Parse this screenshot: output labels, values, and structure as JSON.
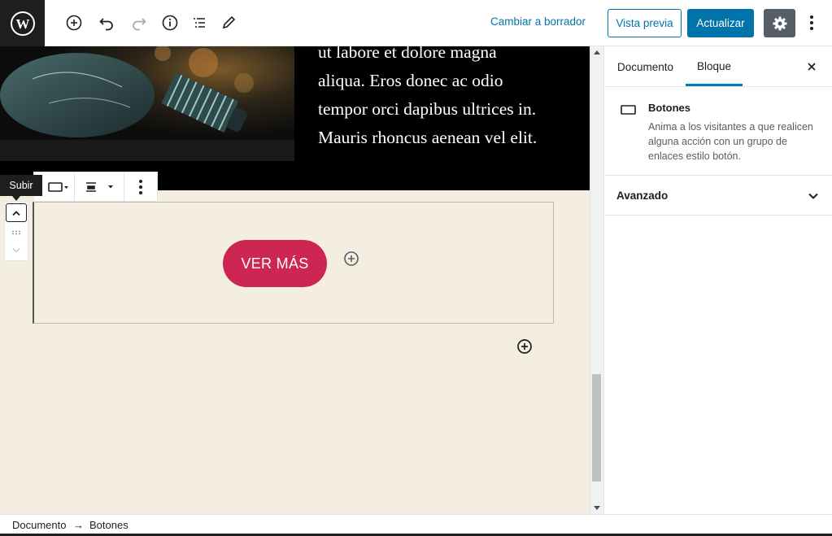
{
  "topbar": {
    "switch_to_draft": "Cambiar a borrador",
    "preview": "Vista previa",
    "update": "Actualizar",
    "icons": [
      "wordpress-icon",
      "add-block-icon",
      "undo-icon",
      "redo-icon",
      "info-icon",
      "list-view-icon",
      "edit-tools-icon",
      "settings-icon",
      "more-options-icon"
    ]
  },
  "canvas": {
    "paragraph_lines": [
      "ut labore et dolore magna",
      "aliqua. Eros donec ac odio",
      "tempor orci dapibus ultrices in.",
      "Mauris rhoncus aenean vel elit."
    ],
    "tooltip": "Subir",
    "button_label": "VER MÁS",
    "button_color": "#cd2653",
    "background_color": "#f3eedf"
  },
  "sidebar": {
    "tabs": [
      "Documento",
      "Bloque"
    ],
    "active_tab": "Bloque",
    "block": {
      "title": "Botones",
      "description": "Anima a los visitantes a que realicen alguna acción con un grupo de enlaces estilo botón."
    },
    "panels": [
      "Avanzado"
    ]
  },
  "footer": {
    "breadcrumb": [
      "Documento",
      "Botones"
    ],
    "separator": "→"
  },
  "accent_color": "#0073aa"
}
